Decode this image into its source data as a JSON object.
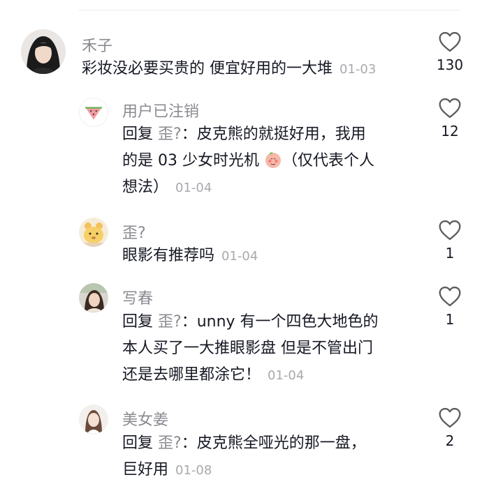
{
  "comments": [
    {
      "user": "禾子",
      "lines": [
        "彩妆没必要买贵的 便宜好用的一大堆"
      ],
      "time": "01-03",
      "likes": "130",
      "avatar_icon": "girl-portrait-avatar"
    },
    {
      "user": "用户已注销",
      "reply_prefix": "回复",
      "reply_to": "歪?",
      "lines": [
        "：皮克熊的就挺好用，我用",
        "的是 03 少女时光机",
        "（仅代表个人",
        "想法）"
      ],
      "emoji_icon": "blushing-peach-emoji",
      "time": "01-04",
      "likes": "12",
      "avatar_icon": "watermelon-avatar"
    },
    {
      "user": "歪?",
      "lines": [
        "眼影有推荐吗"
      ],
      "time": "01-04",
      "likes": "1",
      "avatar_icon": "cartoon-bear-avatar"
    },
    {
      "user": "写春",
      "reply_prefix": "回复",
      "reply_to": "歪?",
      "lines": [
        "：unny 有一个四色大地色的",
        "本人买了一大推眼影盘 但是不管出门",
        "还是去哪里都涂它！"
      ],
      "time": "01-04",
      "likes": "1",
      "avatar_icon": "woman-photo-avatar"
    },
    {
      "user": "美女姜",
      "reply_prefix": "回复",
      "reply_to": "歪?",
      "lines": [
        "：皮克熊全哑光的那一盘，",
        "巨好用"
      ],
      "time": "01-08",
      "likes": "2",
      "avatar_icon": "girl-photo-avatar"
    }
  ],
  "colors": {
    "primary_text": "#161823",
    "secondary_text": "#8a8b91",
    "time_text": "#a8a9ad",
    "heart_stroke": "#5c5c60"
  },
  "icons": {
    "like": "heart-outline-icon"
  }
}
